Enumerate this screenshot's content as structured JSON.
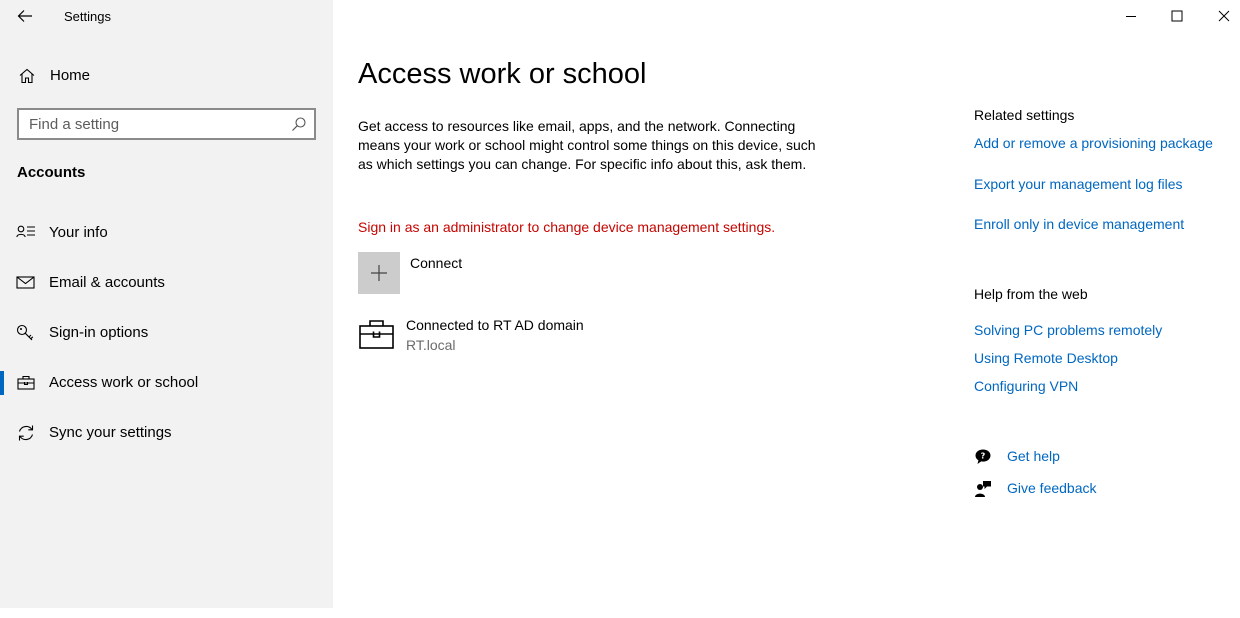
{
  "window": {
    "title": "Settings",
    "controls": {
      "minimize": "minimize-icon",
      "maximize": "maximize-icon",
      "close": "close-icon"
    }
  },
  "sidebar": {
    "home_label": "Home",
    "search_placeholder": "Find a setting",
    "section_title": "Accounts",
    "items": [
      {
        "label": "Your info",
        "icon": "person-info-icon",
        "active": false
      },
      {
        "label": "Email & accounts",
        "icon": "mail-icon",
        "active": false
      },
      {
        "label": "Sign-in options",
        "icon": "key-icon",
        "active": false
      },
      {
        "label": "Access work or school",
        "icon": "briefcase-icon",
        "active": true
      },
      {
        "label": "Sync your settings",
        "icon": "sync-icon",
        "active": false
      }
    ]
  },
  "main": {
    "title": "Access work or school",
    "description": "Get access to resources like email, apps, and the network. Connecting means your work or school might control some things on this device, such as which settings you can change. For specific info about this, ask them.",
    "warning": "Sign in as an administrator to change device management settings.",
    "connect_label": "Connect",
    "account": {
      "name": "Connected to RT AD domain",
      "sub": "RT.local"
    }
  },
  "related": {
    "heading": "Related settings",
    "links": [
      "Add or remove a provisioning package",
      "Export your management log files",
      "Enroll only in device management"
    ]
  },
  "help_web": {
    "heading": "Help from the web",
    "links": [
      "Solving PC problems remotely",
      "Using Remote Desktop",
      "Configuring VPN"
    ]
  },
  "support": {
    "get_help": "Get help",
    "give_feedback": "Give feedback"
  },
  "colors": {
    "accent": "#0067c0",
    "warning": "#c50500",
    "sidebar_bg": "#f2f2f2"
  }
}
